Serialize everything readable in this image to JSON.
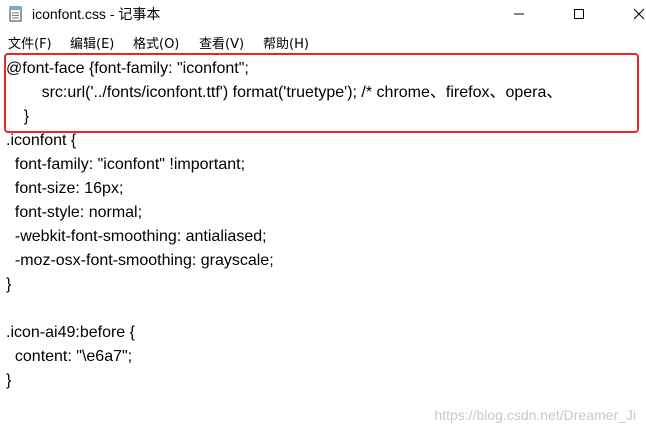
{
  "window": {
    "title": "iconfont.css - 记事本"
  },
  "menu": {
    "items": [
      {
        "label": "文件(F)"
      },
      {
        "label": "编辑(E)"
      },
      {
        "label": "格式(O)"
      },
      {
        "label": "查看(V)"
      },
      {
        "label": "帮助(H)"
      }
    ]
  },
  "editor": {
    "lines": [
      "@font-face {font-family: \"iconfont\";",
      "        src:url('../fonts/iconfont.ttf') format('truetype'); /* chrome、firefox、opera、",
      "    }",
      ".iconfont {",
      "  font-family: \"iconfont\" !important;",
      "  font-size: 16px;",
      "  font-style: normal;",
      "  -webkit-font-smoothing: antialiased;",
      "  -moz-osx-font-smoothing: grayscale;",
      "}",
      "",
      ".icon-ai49:before {",
      "  content: \"\\e6a7\";",
      "}"
    ]
  },
  "watermark": {
    "text": "https://blog.csdn.net/Dreamer_Ji"
  },
  "colors": {
    "highlight": "#e8262c",
    "text": "#000000",
    "watermark": "#c8c8c8"
  },
  "icons": {
    "app": "notepad-icon",
    "minimize": "minimize-icon",
    "maximize": "maximize-icon",
    "close": "close-icon"
  }
}
